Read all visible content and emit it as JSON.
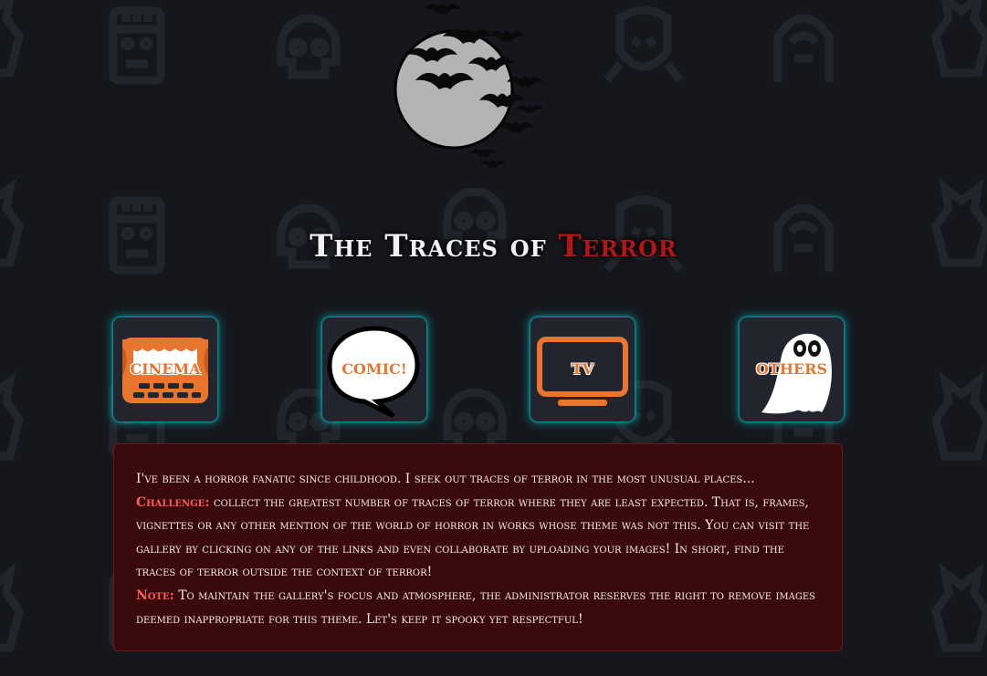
{
  "colors": {
    "background": "#15171c",
    "accent_orange": "#e8742e",
    "terror_red": "#b11616",
    "glow_cyan": "#00c8d2",
    "panel_red": "#3a090c",
    "highlight": "#ff5c5c"
  },
  "header": {
    "logo_icon": "moon-with-bats-icon",
    "title_prefix": "The Traces of ",
    "title_accent": "Terror"
  },
  "categories": [
    {
      "label": "CINEMA",
      "icon": "cinema-icon"
    },
    {
      "label": "COMIC!",
      "icon": "comic-bubble-icon"
    },
    {
      "label": "TV",
      "icon": "tv-icon"
    },
    {
      "label": "OTHERS",
      "icon": "ghost-icon"
    }
  ],
  "info": {
    "intro": "I've been a horror fanatic since childhood. I seek out traces of terror in the most unusual places...",
    "challenge_label": "Challenge:",
    "challenge_text": " collect the greatest number of traces of terror where they are least expected. That is, frames, vignettes or any other mention of the world of horror in works whose theme was not this. You can visit the gallery by clicking on any of the links and even collaborate by uploading your images! In short, find the traces of terror outside the context of terror!",
    "note_label": "Note:",
    "note_text": " To maintain the gallery's focus and atmosphere, the administrator reserves the right to remove images deemed inappropriate for this theme. Let's keep it spooky yet respectful!"
  }
}
